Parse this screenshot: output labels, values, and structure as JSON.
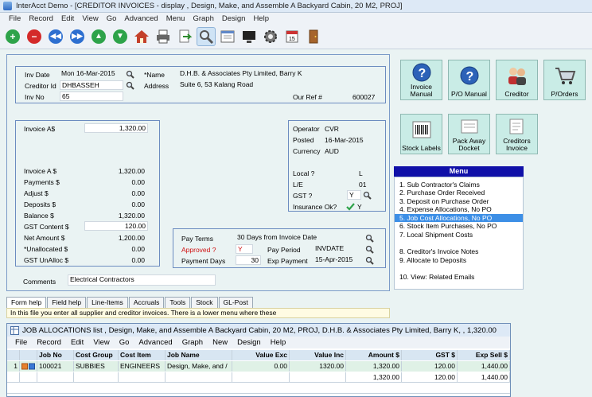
{
  "window": {
    "title": "InterAcct Demo - [CREDITOR INVOICES - display , Design, Make, and Assemble A Backyard Cabin, 20 M2, PROJ]"
  },
  "menubar": [
    "File",
    "Record",
    "Edit",
    "View",
    "Go",
    "Advanced",
    "Menu",
    "Graph",
    "Design",
    "Help"
  ],
  "toolbar": [
    "add-icon",
    "delete-icon",
    "first-record-icon",
    "last-record-icon",
    "up-icon",
    "down-icon",
    "home-icon",
    "print-icon",
    "export-icon",
    "search-icon",
    "form-icon",
    "screen-icon",
    "settings-icon",
    "calendar-icon",
    "door-exit-icon"
  ],
  "header": {
    "inv_date_label": "Inv Date",
    "inv_date": "Mon 16-Mar-2015",
    "creditor_id_label": "Creditor Id",
    "creditor_id": "DHBASSEH",
    "inv_no_label": "Inv No",
    "inv_no": "65",
    "name_label": "*Name",
    "name": "D.H.B. & Associates Pty Limited, Barry K",
    "address_label": "Address",
    "address": "Suite 6, 53 Kalang Road",
    "our_ref_label": "Our Ref #",
    "our_ref": "600027"
  },
  "amounts": {
    "invoice_label": "Invoice   A$",
    "invoice_input": "1,320.00",
    "rows": [
      {
        "label": "Invoice   A $",
        "value": "1,320.00"
      },
      {
        "label": "Payments  $",
        "value": "0.00"
      },
      {
        "label": "Adjust $",
        "value": "0.00"
      },
      {
        "label": "Deposits $",
        "value": "0.00"
      },
      {
        "label": "Balance    $",
        "value": "1,320.00"
      },
      {
        "label": "GST Content  $",
        "value": "120.00"
      },
      {
        "label": "Net Amount   $",
        "value": "1,200.00"
      },
      {
        "label": "*Unallocated $",
        "value": "0.00"
      },
      {
        "label": "GST UnAlloc  $",
        "value": "0.00"
      }
    ]
  },
  "operator": {
    "operator_label": "Operator",
    "operator": "CVR",
    "posted_label": "Posted",
    "posted": "16-Mar-2015",
    "currency_label": "Currency",
    "currency": "AUD",
    "local_label": "Local ?",
    "local": "L",
    "le_label": "L/E",
    "le": "01",
    "gst_label": "GST ?",
    "gst": "Y",
    "insurance_label": "Insurance Ok?",
    "insurance": "Y"
  },
  "payment": {
    "terms_label": "Pay Terms",
    "terms": "30 Days from Invoice Date",
    "approved_label": "Approved ?",
    "approved": "Y",
    "period_label": "Pay Period",
    "period": "INVDATE",
    "days_label": "Payment Days",
    "days": "30",
    "exp_label": "Exp Payment",
    "exp": "15-Apr-2015"
  },
  "comments_label": "Comments",
  "comments": "Electrical Contractors",
  "buttons": [
    {
      "label": "Invoice Manual",
      "icon": "help-icon"
    },
    {
      "label": "P/O Manual",
      "icon": "help-icon"
    },
    {
      "label": "Creditor",
      "icon": "people-icon"
    },
    {
      "label": "P/Orders",
      "icon": "cart-icon"
    },
    {
      "label": "Stock Labels",
      "icon": "barcode-icon"
    },
    {
      "label": "Pack Away Docket",
      "icon": "folder-icon"
    },
    {
      "label": "Creditors Invoice",
      "icon": "document-icon"
    }
  ],
  "menu": {
    "title": "Menu",
    "items": [
      "1. Sub Contractor's Claims",
      "2. Purchase Order Received",
      "3. Deposit on Purchase Order",
      "4. Expense Allocations,  No PO",
      "5. Job Cost Allocations, No PO",
      "6. Stock Item Purchases, No PO",
      "7. Local Shipment Costs",
      "8. Creditor's Invoice Notes",
      "9. Allocate to Deposits",
      "10. View: Related Emails"
    ]
  },
  "tabs": [
    "Form help",
    "Field help",
    "Line-Items",
    "Accruals",
    "Tools",
    "Stock",
    "GL-Post"
  ],
  "help_text": "In this file you enter all supplier and creditor invoices.  There is a lower menu where these",
  "subwindow": {
    "title": "JOB ALLOCATIONS list , Design, Make, and Assemble A Backyard Cabin, 20 M2, PROJ, D.H.B. & Associates Pty Limited, Barry K, , 1,320.00",
    "menu": [
      "File",
      "Record",
      "Edit",
      "View",
      "Go",
      "Advanced",
      "Graph",
      "New",
      "Design",
      "Help"
    ],
    "columns": [
      "",
      "",
      "Job No",
      "Cost Group",
      "Cost Item",
      "Job Name",
      "Value Exc",
      "Value Inc",
      "Amount  $",
      "GST $",
      "Exp Sell $"
    ],
    "rows": [
      [
        "1",
        "",
        "100021",
        "SUBBIES",
        "ENGINEERS",
        "Design, Make, and /",
        "0.00",
        "1320.00",
        "1,320.00",
        "120.00",
        "1,440.00"
      ],
      [
        "",
        "",
        "",
        "",
        "",
        "",
        "",
        "",
        "1,320.00",
        "120.00",
        "1,440.00"
      ]
    ]
  }
}
